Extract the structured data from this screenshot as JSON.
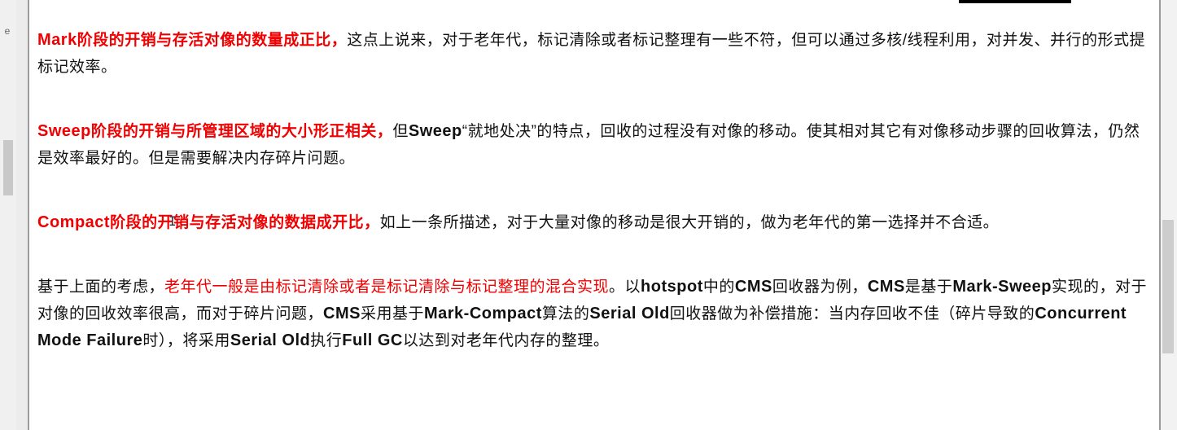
{
  "side_glyph": "e",
  "paragraphs": [
    {
      "red_kw": "Mark",
      "red_text": "阶段的开销与存活对像的数量成正比，",
      "rest": "这点上说来，对于老年代，标记清除或者标记整理有一些不符，但可以通过多核/线程利用，对并发、并行的形式提标记效率。"
    },
    {
      "red_kw": "Sweep",
      "red_text": "阶段的开销与所管理区域的大小形正相关，",
      "t1": "但",
      "kw1": "Sweep",
      "t2": "“就地处决”的特点，回收的过程没有对像的移动。使其相对其它有对像移动步骤的回收算法，仍然是效率最好的。但是需要解决内存碎片问题。"
    },
    {
      "red_kw": "Compact",
      "red_text": "阶段的开销与存活对像的数据成开比，",
      "rest": "如上一条所描述，对于大量对像的移动是很大开销的，做为老年代的第一选择并不合适。"
    },
    {
      "t1": "基于上面的考虑，",
      "red_text": "老年代一般是由标记清除或者是标记清除与标记整理的混合实现",
      "t2": "。以",
      "kw_hotspot": "hotspot",
      "t3": "中的",
      "kw_cms1": "CMS",
      "t4": "回收器为例，",
      "kw_cms2": "CMS",
      "t5": "是基于",
      "kw_marksweep": "Mark-Sweep",
      "t6": "实现的，对于对像的回收效率很高，而对于碎片问题，",
      "kw_cms3": "CMS",
      "t7": "采用基于",
      "kw_markcompact": "Mark-Compact",
      "t8": "算法的",
      "kw_serialold1": "Serial Old",
      "t9": "回收器做为补偿措施：当内存回收不佳（碎片导致的",
      "kw_cmf": "Concurrent Mode Failure",
      "t10": "时），将采用",
      "kw_serialold2": "Serial Old",
      "t11": "执行",
      "kw_fullgc": "Full GC",
      "t12": "以达到对老年代内存的整理。"
    }
  ],
  "colors": {
    "highlight": "#f00000",
    "text": "#111111",
    "page": "#ffffff"
  }
}
